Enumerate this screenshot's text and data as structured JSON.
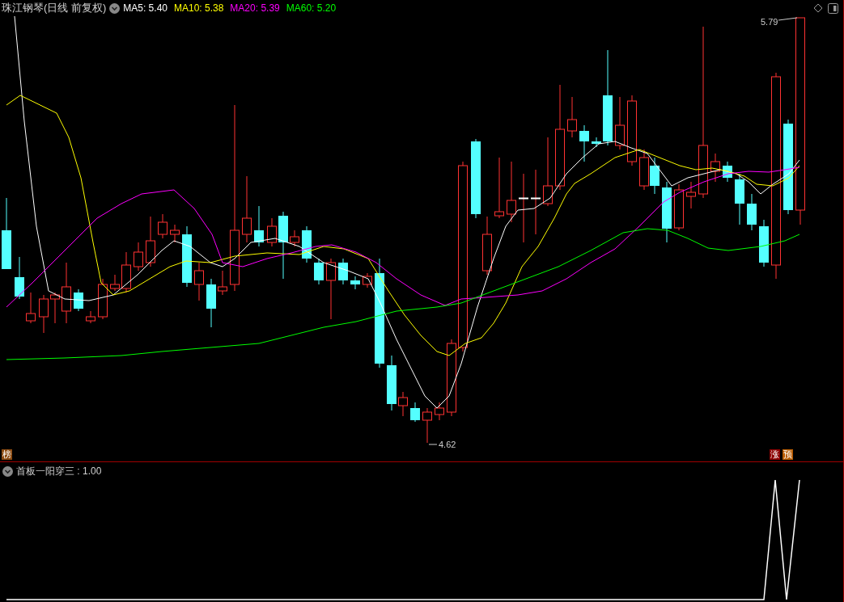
{
  "title": "珠江钢琴(日线 前复权)",
  "moving_averages": [
    {
      "text": "MA5: 5.40",
      "color": "#ffffff"
    },
    {
      "text": "MA10: 5.38",
      "color": "#ffff00"
    },
    {
      "text": "MA20: 5.39",
      "color": "#ff00ff"
    },
    {
      "text": "MA60: 5.20",
      "color": "#00ff00"
    }
  ],
  "price_labels": {
    "high": "5.79",
    "low": "4.62"
  },
  "left_markers": [
    {
      "text": "榜",
      "color": "#8b4a10"
    }
  ],
  "right_markers": [
    {
      "text": "涨",
      "color": "#8b0000"
    },
    {
      "text": "预",
      "color": "#b85c00"
    }
  ],
  "indicator": {
    "text": "首板一阳穿三 : 1.00"
  }
}
